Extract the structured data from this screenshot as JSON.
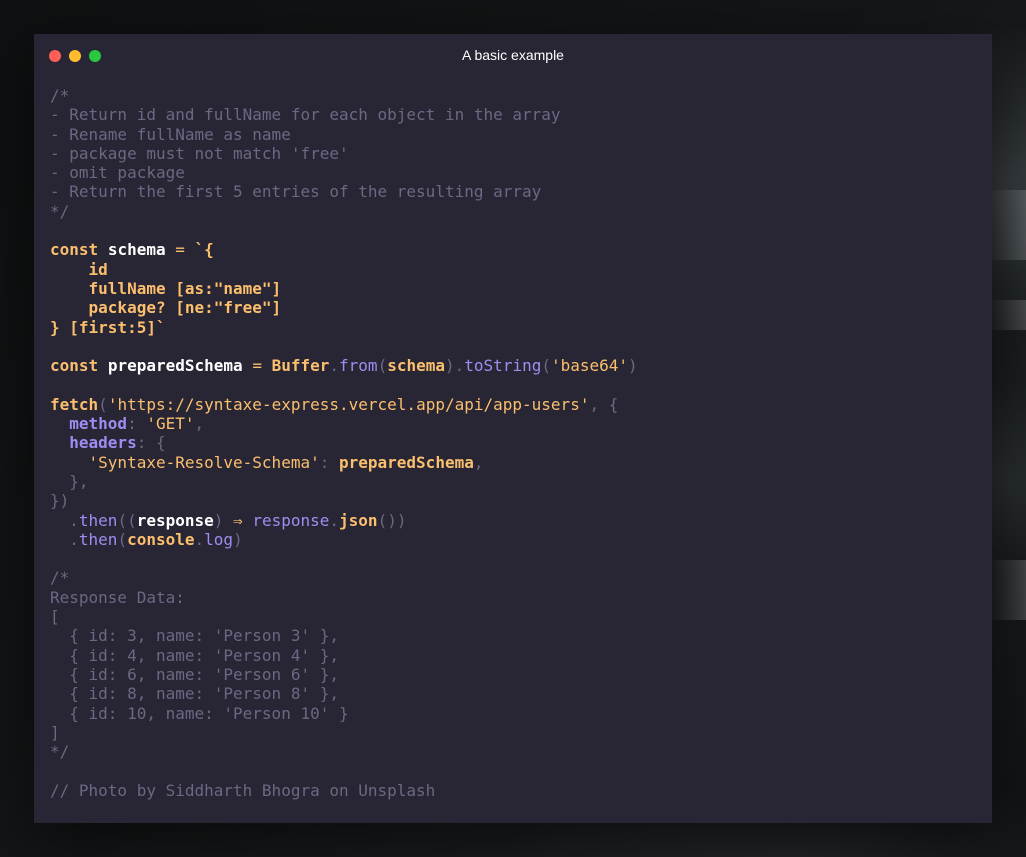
{
  "window": {
    "title": "A basic example"
  },
  "code": {
    "comment_open": "/*",
    "comment_lines": [
      "- Return id and fullName for each object in the array",
      "- Rename fullName as name",
      "- package must not match 'free'",
      "- omit package",
      "- Return the first 5 entries of the resulting array"
    ],
    "comment_close": "*/",
    "kw_const": "const",
    "schema_var": "schema",
    "eq": "=",
    "schema_open": "`{",
    "schema_lines": [
      "    id",
      "    fullName [as:\"name\"]",
      "    package? [ne:\"free\"]"
    ],
    "schema_close": "} [first:5]`",
    "prepared_var": "preparedSchema",
    "buffer": "Buffer",
    "dot": ".",
    "from": "from",
    "lparen": "(",
    "rparen": ")",
    "to_string": "toString",
    "base64": "'base64'",
    "fetch": "fetch",
    "url": "'https://syntaxe-express.vercel.app/api/app-users'",
    "comma_brace": ", {",
    "method_key": "method",
    "colon": ": ",
    "method_value": "'GET'",
    "comma": ",",
    "headers_key": "headers",
    "brace_open": "{",
    "header_name": "'Syntaxe-Resolve-Schema'",
    "close_inner": "},",
    "close_call": "})",
    "then": "then",
    "double_lparen": "((",
    "response": "response",
    "arrow": "⇒",
    "json": "json",
    "empty_call": "())",
    "console": "console",
    "log": "log",
    "response_comment_open": "/*",
    "response_label": "Response Data:",
    "array_open": "[",
    "response_lines": [
      "  { id: 3, name: 'Person 3' },",
      "  { id: 4, name: 'Person 4' },",
      "  { id: 6, name: 'Person 6' },",
      "  { id: 8, name: 'Person 8' },",
      "  { id: 10, name: 'Person 10' }"
    ],
    "array_close": "]",
    "response_comment_close": "*/",
    "credit": "// Photo by Siddharth Bhogra on Unsplash"
  }
}
